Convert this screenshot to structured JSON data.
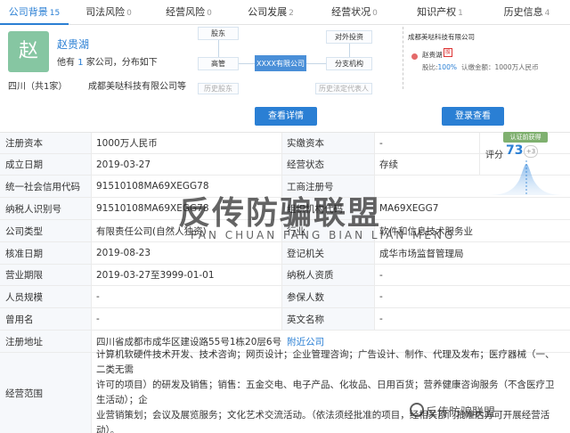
{
  "tabs": [
    {
      "label": "公司背景",
      "count": "15",
      "active": true
    },
    {
      "label": "司法风险",
      "count": "0"
    },
    {
      "label": "经营风险",
      "count": "0"
    },
    {
      "label": "公司发展",
      "count": "2"
    },
    {
      "label": "经营状况",
      "count": "0"
    },
    {
      "label": "知识产权",
      "count": "1"
    },
    {
      "label": "历史信息",
      "count": "4"
    }
  ],
  "person": {
    "avatar_char": "赵",
    "name": "赵贵湖",
    "desc_prefix": "他有",
    "desc_count": "1",
    "desc_suffix": "家公司，分布如下",
    "region": "四川（共1家）",
    "company": "成都美哒科技有限公司等"
  },
  "diagram": {
    "shareholder": "股东",
    "invest": "对外投资",
    "exec": "高管",
    "center": "XXXX有限公司",
    "branch": "分支机构",
    "hist_shareholder": "历史股东",
    "hist_legal": "历史法定代表人",
    "button": "查看详情"
  },
  "equity": {
    "company": "成都美哒科技有限公司",
    "holder": "赵贵湖",
    "tag": "股",
    "share_label": "股比:",
    "share_value": "100%",
    "capital": "认缴金额：1000万人民币",
    "button": "登录查看"
  },
  "score": {
    "badge": "认证前获得",
    "label": "评分",
    "value": "73",
    "delta": "+3"
  },
  "rows": [
    {
      "l1": "注册资本",
      "v1": "1000万人民币",
      "l2": "实缴资本",
      "v2": "-"
    },
    {
      "l1": "成立日期",
      "v1": "2019-03-27",
      "l2": "经营状态",
      "v2": "存续"
    },
    {
      "l1": "统一社会信用代码",
      "v1": "91510108MA69XEGG78",
      "l2": "工商注册号",
      "v2": ""
    },
    {
      "l1": "纳税人识别号",
      "v1": "91510108MA69XEGG78",
      "l2": "组织机构代码",
      "v2": "MA69XEGG7"
    },
    {
      "l1": "公司类型",
      "v1": "有限责任公司(自然人独资)",
      "l2": "行业",
      "v2": "软件和信息技术服务业"
    },
    {
      "l1": "核准日期",
      "v1": "2019-08-23",
      "l2": "登记机关",
      "v2": "成华市场监督管理局"
    },
    {
      "l1": "营业期限",
      "v1": "2019-03-27至3999-01-01",
      "l2": "纳税人资质",
      "v2": "-"
    },
    {
      "l1": "人员规模",
      "v1": "-",
      "l2": "参保人数",
      "v2": "-"
    },
    {
      "l1": "曾用名",
      "v1": "-",
      "l2": "英文名称",
      "v2": "-"
    }
  ],
  "address": {
    "label": "注册地址",
    "value": "四川省成都市成华区建设路55号1栋20层6号",
    "link": "附近公司"
  },
  "scope": {
    "label": "经营范围",
    "line1": "计算机软硬件技术开发、技术咨询；网页设计；企业管理咨询；广告设计、制作、代理及发布；医疗器械（一、二类无需",
    "line2": "许可的项目）的研发及销售；销售：五金交电、电子产品、化妆品、日用百货；营养健康咨询服务（不含医疗卫生活动）；企",
    "line3": "业营销策划；会议及展览服务；文化艺术交流活动。（依法须经批准的项目，经相关部门批准后方可开展经营活动）。"
  },
  "watermark": {
    "cn": "反传防骗联盟",
    "en": "FAN CHUAN FANG BIAN LIAN MENG",
    "small": "反传防骗联盟"
  }
}
